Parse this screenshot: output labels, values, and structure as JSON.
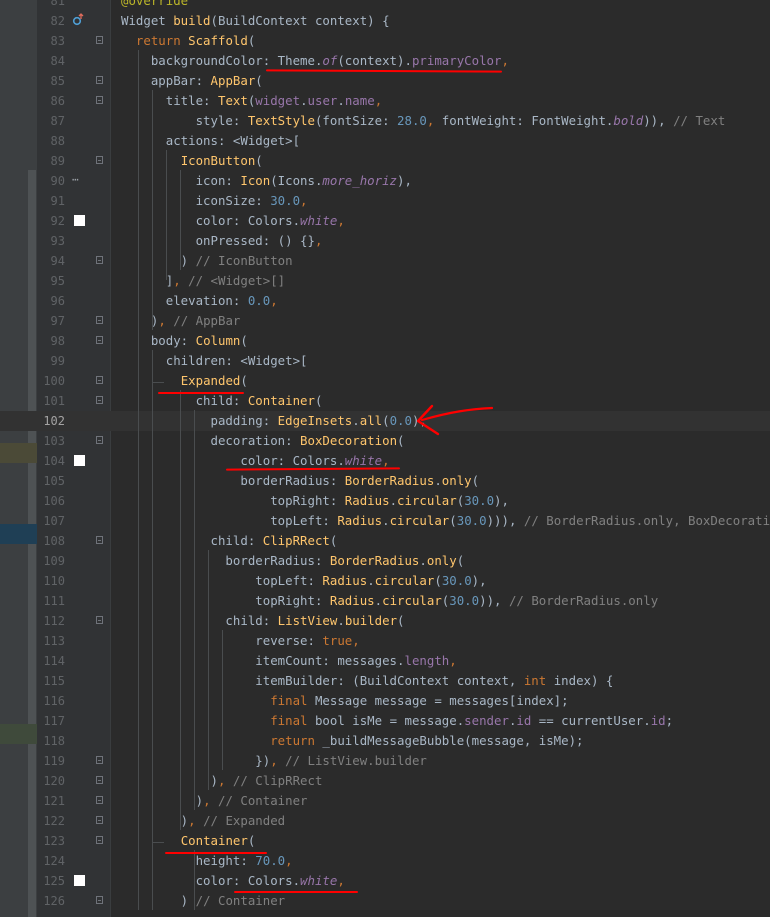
{
  "editor": {
    "caret_line": 102,
    "lines": [
      {
        "num": "81",
        "code": [
          [
            "an",
            "@override"
          ]
        ]
      },
      {
        "num": "82",
        "code": [
          [
            "t",
            "Widget "
          ],
          [
            "c",
            "build"
          ],
          [
            "t",
            "(BuildContext context) {"
          ]
        ]
      },
      {
        "num": "83",
        "code": [
          [
            "t",
            "  "
          ],
          [
            "k",
            "return "
          ],
          [
            "c",
            "Scaffold"
          ],
          [
            "t",
            "("
          ]
        ]
      },
      {
        "num": "84",
        "code": [
          [
            "t",
            "    backgroundColor: Theme."
          ],
          [
            "pi",
            "of"
          ],
          [
            "t",
            "(context)."
          ],
          [
            "p",
            "primaryColor"
          ],
          [
            "k",
            ","
          ]
        ]
      },
      {
        "num": "85",
        "code": [
          [
            "t",
            "    appBar: "
          ],
          [
            "c",
            "AppBar"
          ],
          [
            "t",
            "("
          ]
        ]
      },
      {
        "num": "86",
        "code": [
          [
            "t",
            "      title: "
          ],
          [
            "c",
            "Text"
          ],
          [
            "t",
            "("
          ],
          [
            "p",
            "widget"
          ],
          [
            "t",
            "."
          ],
          [
            "p",
            "user"
          ],
          [
            "t",
            "."
          ],
          [
            "p",
            "name"
          ],
          [
            "k",
            ","
          ]
        ]
      },
      {
        "num": "87",
        "code": [
          [
            "t",
            "          style: "
          ],
          [
            "c",
            "TextStyle"
          ],
          [
            "t",
            "(fontSize: "
          ],
          [
            "n",
            "28.0"
          ],
          [
            "k",
            ", "
          ],
          [
            "t",
            "fontWeight: FontWeight."
          ],
          [
            "pi",
            "bold"
          ],
          [
            "t",
            ")), "
          ],
          [
            "cm",
            "// Text"
          ]
        ]
      },
      {
        "num": "88",
        "code": [
          [
            "t",
            "      actions: <Widget>["
          ]
        ]
      },
      {
        "num": "89",
        "code": [
          [
            "t",
            "        "
          ],
          [
            "c",
            "IconButton"
          ],
          [
            "t",
            "("
          ]
        ]
      },
      {
        "num": "90",
        "code": [
          [
            "t",
            "          icon: "
          ],
          [
            "c",
            "Icon"
          ],
          [
            "t",
            "(Icons."
          ],
          [
            "pi",
            "more_horiz"
          ],
          [
            "t",
            "),"
          ]
        ]
      },
      {
        "num": "91",
        "code": [
          [
            "t",
            "          iconSize: "
          ],
          [
            "n",
            "30.0"
          ],
          [
            "k",
            ","
          ]
        ]
      },
      {
        "num": "92",
        "code": [
          [
            "t",
            "          color: Colors."
          ],
          [
            "pi",
            "white"
          ],
          [
            "k",
            ","
          ]
        ]
      },
      {
        "num": "93",
        "code": [
          [
            "t",
            "          onPressed: () {}"
          ],
          [
            "k",
            ","
          ]
        ]
      },
      {
        "num": "94",
        "code": [
          [
            "t",
            "        ) "
          ],
          [
            "cm",
            "// IconButton"
          ]
        ]
      },
      {
        "num": "95",
        "code": [
          [
            "t",
            "      ]"
          ],
          [
            "k",
            ", "
          ],
          [
            "cm",
            "// <Widget>[]"
          ]
        ]
      },
      {
        "num": "96",
        "code": [
          [
            "t",
            "      elevation: "
          ],
          [
            "n",
            "0.0"
          ],
          [
            "k",
            ","
          ]
        ]
      },
      {
        "num": "97",
        "code": [
          [
            "t",
            "    )"
          ],
          [
            "k",
            ", "
          ],
          [
            "cm",
            "// AppBar"
          ]
        ]
      },
      {
        "num": "98",
        "code": [
          [
            "t",
            "    body: "
          ],
          [
            "c",
            "Column"
          ],
          [
            "t",
            "("
          ]
        ]
      },
      {
        "num": "99",
        "code": [
          [
            "t",
            "      children: <Widget>["
          ]
        ]
      },
      {
        "num": "100",
        "code": [
          [
            "t",
            "        "
          ],
          [
            "c",
            "Expanded"
          ],
          [
            "t",
            "("
          ]
        ]
      },
      {
        "num": "101",
        "code": [
          [
            "t",
            "          child: "
          ],
          [
            "c",
            "Container"
          ],
          [
            "t",
            "("
          ]
        ]
      },
      {
        "num": "102",
        "code": [
          [
            "t",
            "            padding: "
          ],
          [
            "c",
            "EdgeInsets"
          ],
          [
            "t",
            "."
          ],
          [
            "c",
            "all"
          ],
          [
            "t",
            "("
          ],
          [
            "n",
            "0.0"
          ],
          [
            "t",
            "),"
          ]
        ]
      },
      {
        "num": "103",
        "code": [
          [
            "t",
            "            decoration: "
          ],
          [
            "c",
            "BoxDecoration"
          ],
          [
            "t",
            "("
          ]
        ]
      },
      {
        "num": "104",
        "code": [
          [
            "t",
            "                color: Colors."
          ],
          [
            "pi",
            "white"
          ],
          [
            "k",
            ","
          ]
        ]
      },
      {
        "num": "105",
        "code": [
          [
            "t",
            "                borderRadius: "
          ],
          [
            "c",
            "BorderRadius"
          ],
          [
            "t",
            "."
          ],
          [
            "c",
            "only"
          ],
          [
            "t",
            "("
          ]
        ]
      },
      {
        "num": "106",
        "code": [
          [
            "t",
            "                    topRight: "
          ],
          [
            "c",
            "Radius"
          ],
          [
            "t",
            "."
          ],
          [
            "c",
            "circular"
          ],
          [
            "t",
            "("
          ],
          [
            "n",
            "30.0"
          ],
          [
            "t",
            "),"
          ]
        ]
      },
      {
        "num": "107",
        "code": [
          [
            "t",
            "                    topLeft: "
          ],
          [
            "c",
            "Radius"
          ],
          [
            "t",
            "."
          ],
          [
            "c",
            "circular"
          ],
          [
            "t",
            "("
          ],
          [
            "n",
            "30.0"
          ],
          [
            "t",
            "))), "
          ],
          [
            "cm",
            "// BorderRadius.only, BoxDecoration"
          ]
        ]
      },
      {
        "num": "108",
        "code": [
          [
            "t",
            "            child: "
          ],
          [
            "c",
            "ClipRRect"
          ],
          [
            "t",
            "("
          ]
        ]
      },
      {
        "num": "109",
        "code": [
          [
            "t",
            "              borderRadius: "
          ],
          [
            "c",
            "BorderRadius"
          ],
          [
            "t",
            "."
          ],
          [
            "c",
            "only"
          ],
          [
            "t",
            "("
          ]
        ]
      },
      {
        "num": "110",
        "code": [
          [
            "t",
            "                  topLeft: "
          ],
          [
            "c",
            "Radius"
          ],
          [
            "t",
            "."
          ],
          [
            "c",
            "circular"
          ],
          [
            "t",
            "("
          ],
          [
            "n",
            "30.0"
          ],
          [
            "t",
            "),"
          ]
        ]
      },
      {
        "num": "111",
        "code": [
          [
            "t",
            "                  topRight: "
          ],
          [
            "c",
            "Radius"
          ],
          [
            "t",
            "."
          ],
          [
            "c",
            "circular"
          ],
          [
            "t",
            "("
          ],
          [
            "n",
            "30.0"
          ],
          [
            "t",
            ")), "
          ],
          [
            "cm",
            "// BorderRadius.only"
          ]
        ]
      },
      {
        "num": "112",
        "code": [
          [
            "t",
            "              child: "
          ],
          [
            "c",
            "ListView"
          ],
          [
            "t",
            "."
          ],
          [
            "c",
            "builder"
          ],
          [
            "t",
            "("
          ]
        ]
      },
      {
        "num": "113",
        "code": [
          [
            "t",
            "                  reverse: "
          ],
          [
            "k",
            "true"
          ],
          [
            "k",
            ","
          ]
        ]
      },
      {
        "num": "114",
        "code": [
          [
            "t",
            "                  itemCount: messages."
          ],
          [
            "p",
            "length"
          ],
          [
            "k",
            ","
          ]
        ]
      },
      {
        "num": "115",
        "code": [
          [
            "t",
            "                  itemBuilder: (BuildContext context, "
          ],
          [
            "k",
            "int "
          ],
          [
            "t",
            "index) {"
          ]
        ]
      },
      {
        "num": "116",
        "code": [
          [
            "t",
            "                    "
          ],
          [
            "k",
            "final "
          ],
          [
            "t",
            "Message message = messages[index];"
          ]
        ]
      },
      {
        "num": "117",
        "code": [
          [
            "t",
            "                    "
          ],
          [
            "k",
            "final "
          ],
          [
            "t",
            "bool isMe = message."
          ],
          [
            "p",
            "sender"
          ],
          [
            "t",
            "."
          ],
          [
            "p",
            "id"
          ],
          [
            "t",
            " == currentUser."
          ],
          [
            "p",
            "id"
          ],
          [
            "t",
            ";"
          ]
        ]
      },
      {
        "num": "118",
        "code": [
          [
            "t",
            "                    "
          ],
          [
            "k",
            "return "
          ],
          [
            "t",
            "_buildMessageBubble(message, isMe);"
          ]
        ]
      },
      {
        "num": "119",
        "code": [
          [
            "t",
            "                  })"
          ],
          [
            "k",
            ", "
          ],
          [
            "cm",
            "// ListView.builder"
          ]
        ]
      },
      {
        "num": "120",
        "code": [
          [
            "t",
            "            )"
          ],
          [
            "k",
            ", "
          ],
          [
            "cm",
            "// ClipRRect"
          ]
        ]
      },
      {
        "num": "121",
        "code": [
          [
            "t",
            "          )"
          ],
          [
            "k",
            ", "
          ],
          [
            "cm",
            "// Container"
          ]
        ]
      },
      {
        "num": "122",
        "code": [
          [
            "t",
            "        )"
          ],
          [
            "k",
            ", "
          ],
          [
            "cm",
            "// Expanded"
          ]
        ]
      },
      {
        "num": "123",
        "code": [
          [
            "t",
            "        "
          ],
          [
            "c",
            "Container"
          ],
          [
            "t",
            "("
          ]
        ]
      },
      {
        "num": "124",
        "code": [
          [
            "t",
            "          height: "
          ],
          [
            "n",
            "70.0"
          ],
          [
            "k",
            ","
          ]
        ]
      },
      {
        "num": "125",
        "code": [
          [
            "t",
            "          color: Colors."
          ],
          [
            "pi",
            "white"
          ],
          [
            "k",
            ","
          ]
        ]
      },
      {
        "num": "126",
        "code": [
          [
            "t",
            "        ) "
          ],
          [
            "cm",
            "// Container"
          ]
        ]
      }
    ],
    "color_swatch_lines": [
      "92",
      "104",
      "125"
    ],
    "ellipsis_line": "90",
    "override_line": "82",
    "ellipsis_glyph": "⋯",
    "fold_lines": [
      "83",
      "85",
      "86",
      "89",
      "94",
      "97",
      "98",
      "100",
      "101",
      "103",
      "108",
      "112",
      "119",
      "120",
      "121",
      "122",
      "123",
      "126"
    ]
  },
  "colors": {
    "background": "#2b2b2b",
    "gutter": "#313335",
    "keyword": "#cc7832",
    "function": "#ffc66d",
    "property": "#9876aa",
    "number": "#6897bb",
    "comment": "#808080",
    "annotation": "#bbb529",
    "annotation_marks": "#ff0000"
  }
}
